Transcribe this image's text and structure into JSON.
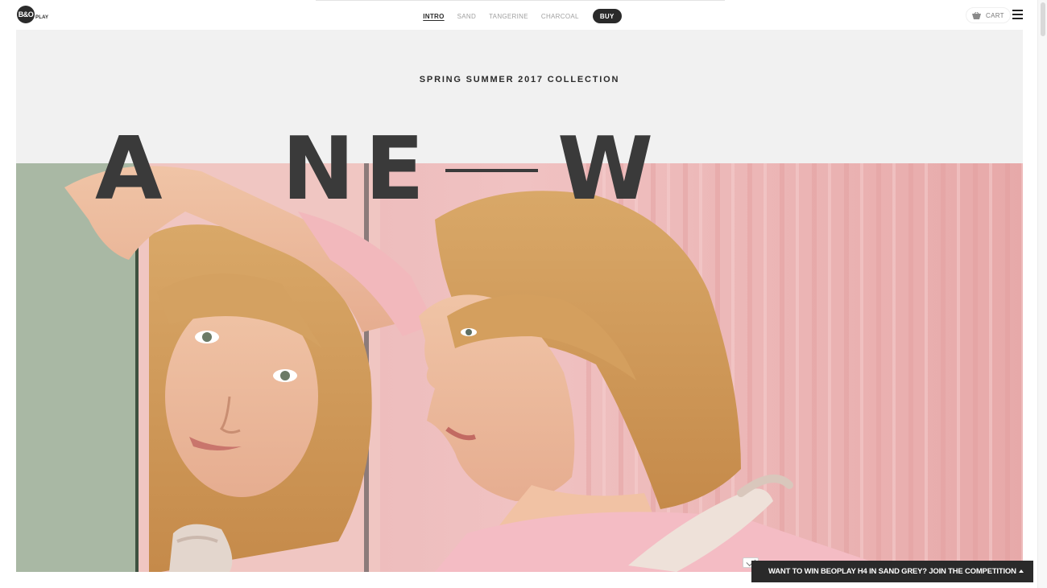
{
  "brand": {
    "logo_mark": "B&O",
    "logo_sub": "PLAY"
  },
  "nav": {
    "links": [
      {
        "label": "INTRO",
        "active": true
      },
      {
        "label": "SAND",
        "active": false
      },
      {
        "label": "TANGERINE",
        "active": false
      },
      {
        "label": "CHARCOAL",
        "active": false
      }
    ],
    "buy_label": "BUY"
  },
  "header_actions": {
    "cart_label": "CART",
    "cart_icon": "basket-icon",
    "menu_icon": "hamburger-menu-icon"
  },
  "hero": {
    "eyebrow": "SPRING SUMMER 2017 COLLECTION",
    "headline_letters": [
      "A",
      "N",
      "E",
      "W"
    ],
    "image": "portrait-photo-woman-mirror-headphones"
  },
  "promo": {
    "text": "WANT TO WIN BEOPLAY H4 IN SAND GREY?  JOIN THE COMPETITION",
    "toggle_icon": "caret-up-icon",
    "mail_icon": "envelope-icon"
  },
  "colors": {
    "accent": "#2a2a2a",
    "hero_bg": "#f1f1f1",
    "photo_pink": "#e9b2b2",
    "headline": "#3a3a3a"
  }
}
